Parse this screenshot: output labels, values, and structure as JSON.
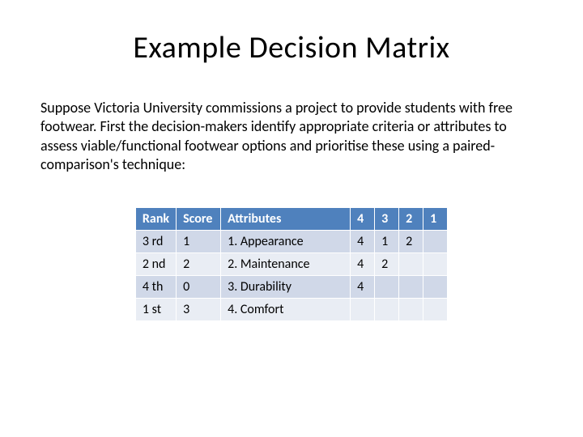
{
  "title": "Example Decision Matrix",
  "paragraph": "Suppose Victoria University commissions a project to provide students with free footwear.  First the decision-makers identify appropriate criteria or attributes to assess viable/functional footwear options and prioritise these using a paired-comparison's technique:",
  "table": {
    "headers": {
      "rank": "Rank",
      "score": "Score",
      "attributes": "Attributes",
      "c4": "4",
      "c3": "3",
      "c2": "2",
      "c1": "1"
    },
    "rows": [
      {
        "rank": "3 rd",
        "score": "1",
        "attr": "1. Appearance",
        "c4": "4",
        "c3": "1",
        "c2": "2",
        "c1": ""
      },
      {
        "rank": "2 nd",
        "score": "2",
        "attr": "2. Maintenance",
        "c4": "4",
        "c3": "2",
        "c2": "",
        "c1": ""
      },
      {
        "rank": "4 th",
        "score": "0",
        "attr": "3. Durability",
        "c4": "4",
        "c3": "",
        "c2": "",
        "c1": ""
      },
      {
        "rank": "1 st",
        "score": "3",
        "attr": "4. Comfort",
        "c4": "",
        "c3": "",
        "c2": "",
        "c1": ""
      }
    ]
  }
}
